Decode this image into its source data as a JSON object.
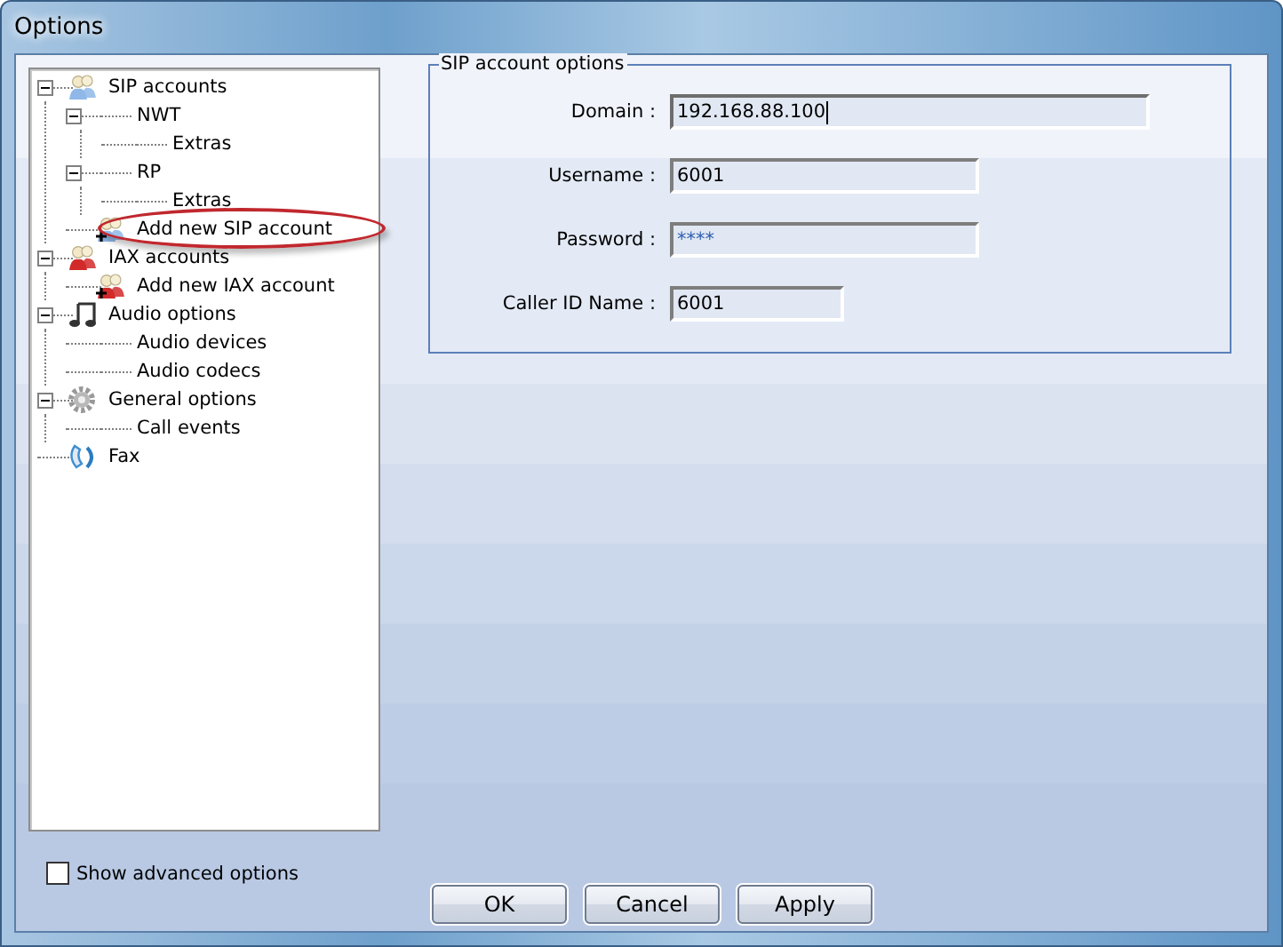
{
  "window": {
    "title": "Options"
  },
  "tree": [
    {
      "label": "SIP accounts",
      "kind": "sip",
      "expanded": true,
      "highlighted": false,
      "children": [
        {
          "label": "NWT",
          "expanded": true,
          "highlighted": false,
          "children": [
            {
              "label": "Extras",
              "highlighted": false
            }
          ]
        },
        {
          "label": "RP",
          "expanded": true,
          "highlighted": false,
          "children": [
            {
              "label": "Extras",
              "highlighted": false
            }
          ]
        },
        {
          "label": "Add new SIP account",
          "kind": "add-sip",
          "highlighted": true
        }
      ]
    },
    {
      "label": "IAX accounts",
      "kind": "iax",
      "expanded": true,
      "highlighted": false,
      "children": [
        {
          "label": "Add new IAX account",
          "kind": "add-iax",
          "highlighted": false
        }
      ]
    },
    {
      "label": "Audio options",
      "kind": "audio",
      "expanded": true,
      "highlighted": false,
      "children": [
        {
          "label": "Audio devices",
          "highlighted": false
        },
        {
          "label": "Audio codecs",
          "highlighted": false
        }
      ]
    },
    {
      "label": "General options",
      "kind": "general",
      "expanded": true,
      "highlighted": false,
      "children": [
        {
          "label": "Call events",
          "highlighted": false
        }
      ]
    },
    {
      "label": "Fax",
      "kind": "fax",
      "highlighted": false
    }
  ],
  "group": {
    "title": "SIP account options",
    "fields": [
      {
        "label": "Domain :",
        "value": "192.168.88.100",
        "focused": true
      },
      {
        "label": "Username :",
        "value": "6001",
        "focused": false
      },
      {
        "label": "Password :",
        "value": "****",
        "focused": false,
        "kind": "password"
      },
      {
        "label": "Caller ID Name :",
        "value": "6001",
        "focused": false
      }
    ]
  },
  "show_advanced": {
    "label": "Show advanced options",
    "checked": false
  },
  "buttons": [
    "OK",
    "Cancel",
    "Apply"
  ]
}
